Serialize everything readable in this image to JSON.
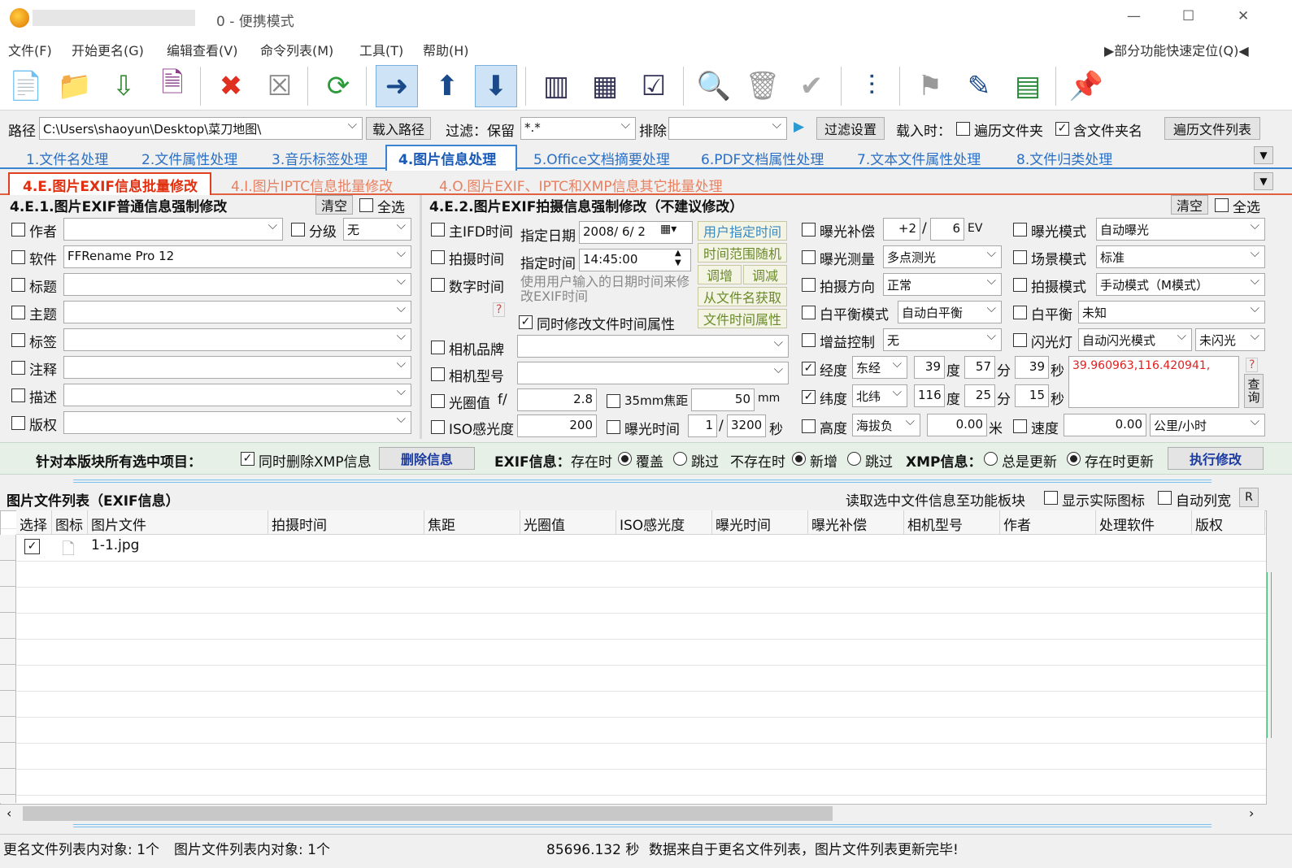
{
  "window": {
    "title": "0 - 便携模式",
    "min": "—",
    "max": "☐",
    "close": "✕"
  },
  "menu": {
    "items": [
      "文件(F)",
      "开始更名(G)",
      "编辑查看(V)",
      "命令列表(M)",
      "工具(T)",
      "帮助(H)"
    ],
    "quick": "▶部分功能快速定位(Q)◀"
  },
  "pathbar": {
    "path_label": "路径",
    "path": "C:\\Users\\shaoyun\\Desktop\\菜刀地图\\",
    "load": "载入路径",
    "filter_label": "过滤：保留",
    "filter": "*.*",
    "exclude_label": "排除",
    "filter_settings": "过滤设置",
    "load_when": "载入时：",
    "traverse": "遍历文件夹",
    "include_folder": "含文件夹名",
    "traverse_list": "遍历文件列表"
  },
  "tabs": [
    "1.文件名处理",
    "2.文件属性处理",
    "3.音乐标签处理",
    "4.图片信息处理",
    "5.Office文档摘要处理",
    "6.PDF文档属性处理",
    "7.文本文件属性处理",
    "8.文件归类处理"
  ],
  "subtabs": [
    "4.E.图片EXIF信息批量修改",
    "4.I.图片IPTC信息批量修改",
    "4.O.图片EXIF、IPTC和XMP信息其它批量处理"
  ],
  "left": {
    "title": "4.E.1.图片EXIF普通信息强制修改",
    "clear": "清空",
    "select_all": "全选",
    "author": "作者",
    "rating": "分级",
    "rating_value": "无",
    "software": "软件",
    "software_value": "FFRename Pro 12",
    "fields": [
      "标题",
      "主题",
      "标签",
      "注释",
      "描述",
      "版权"
    ]
  },
  "right": {
    "title": "4.E.2.图片EXIF拍摄信息强制修改（不建议修改）",
    "clear": "清空",
    "select_all": "全选",
    "ifd_time": "主IFD时间",
    "shoot_time": "拍摄时间",
    "digital_time": "数字时间",
    "date_label": "指定日期",
    "date": "2008/ 6/ 2",
    "time_label": "指定时间",
    "time": "14:45:00",
    "hint": "使用用户输入的日期时间来修改EXIF时间",
    "q": "?",
    "b_user": "用户指定时间",
    "b_range": "时间范围随机",
    "b_inc": "调增",
    "b_dec": "调减",
    "b_fromname": "从文件名获取",
    "b_fileattr": "文件时间属性",
    "sync_file_time": "同时修改文件时间属性",
    "maker": "相机品牌",
    "model": "相机型号",
    "aperture": "光圈值",
    "aperture_f": "f/",
    "aperture_v": "2.8",
    "focal35": "35mm焦距",
    "focal_v": "50",
    "mm": "mm",
    "iso": "ISO感光度",
    "iso_v": "200",
    "exposure": "曝光时间",
    "exp_n": "1",
    "exp_d": "3200",
    "sec": "秒",
    "ev_comp": "曝光补偿",
    "ev_n": "+2",
    "ev_d": "6",
    "ev": "EV",
    "metering": "曝光测量",
    "metering_v": "多点测光",
    "orient": "拍摄方向",
    "orient_v": "正常",
    "wb_mode": "白平衡模式",
    "wb_mode_v": "自动白平衡",
    "gain": "增益控制",
    "gain_v": "无",
    "lon": "经度",
    "lon_dir": "东经",
    "lon_d": "39",
    "lon_m": "57",
    "lon_s": "39",
    "lat": "纬度",
    "lat_dir": "北纬",
    "lat_d": "116",
    "lat_m": "25",
    "lat_s": "15",
    "deg": "度",
    "min": "分",
    "secs": "秒",
    "coord": "39.960963,116.420941,",
    "query": "查询",
    "alt": "高度",
    "alt_ref": "海拔负",
    "alt_v": "0.00",
    "meter": "米",
    "speed": "速度",
    "speed_v": "0.00",
    "speed_unit": "公里/小时",
    "exp_mode": "曝光模式",
    "exp_mode_v": "自动曝光",
    "scene": "场景模式",
    "scene_v": "标准",
    "shoot_mode": "拍摄模式",
    "shoot_mode_v": "手动模式（M模式）",
    "wb": "白平衡",
    "wb_v": "未知",
    "flash": "闪光灯",
    "flash_v": "自动闪光模式",
    "flash_v2": "未闪光"
  },
  "actionbar": {
    "label": "针对本版块所有选中项目：",
    "del_xmp": "同时删除XMP信息",
    "del_btn": "删除信息",
    "exif_label": "EXIF信息：",
    "exists": "存在时",
    "overwrite": "覆盖",
    "skip": "跳过",
    "not_exists": "不存在时",
    "add": "新增",
    "skip2": "跳过",
    "xmp_label": "XMP信息：",
    "always": "总是更新",
    "when_exists": "存在时更新",
    "execute": "执行修改"
  },
  "list": {
    "title": "图片文件列表（EXIF信息）",
    "read_btn": "读取选中文件信息至功能板块",
    "real_icon": "显示实际图标",
    "auto_width": "自动列宽",
    "r": "R",
    "columns": [
      "选择",
      "图标",
      "图片文件",
      "拍摄时间",
      "焦距",
      "光圈值",
      "ISO感光度",
      "曝光时间",
      "曝光补偿",
      "相机型号",
      "作者",
      "处理软件",
      "版权"
    ],
    "rows": [
      {
        "file": "1-1.jpg"
      }
    ]
  },
  "status": {
    "rename_count": "更名文件列表内对象: 1个",
    "image_count": "图片文件列表内对象: 1个",
    "time": "85696.132 秒",
    "message": "数据来自于更名文件列表，图片文件列表更新完毕!"
  }
}
